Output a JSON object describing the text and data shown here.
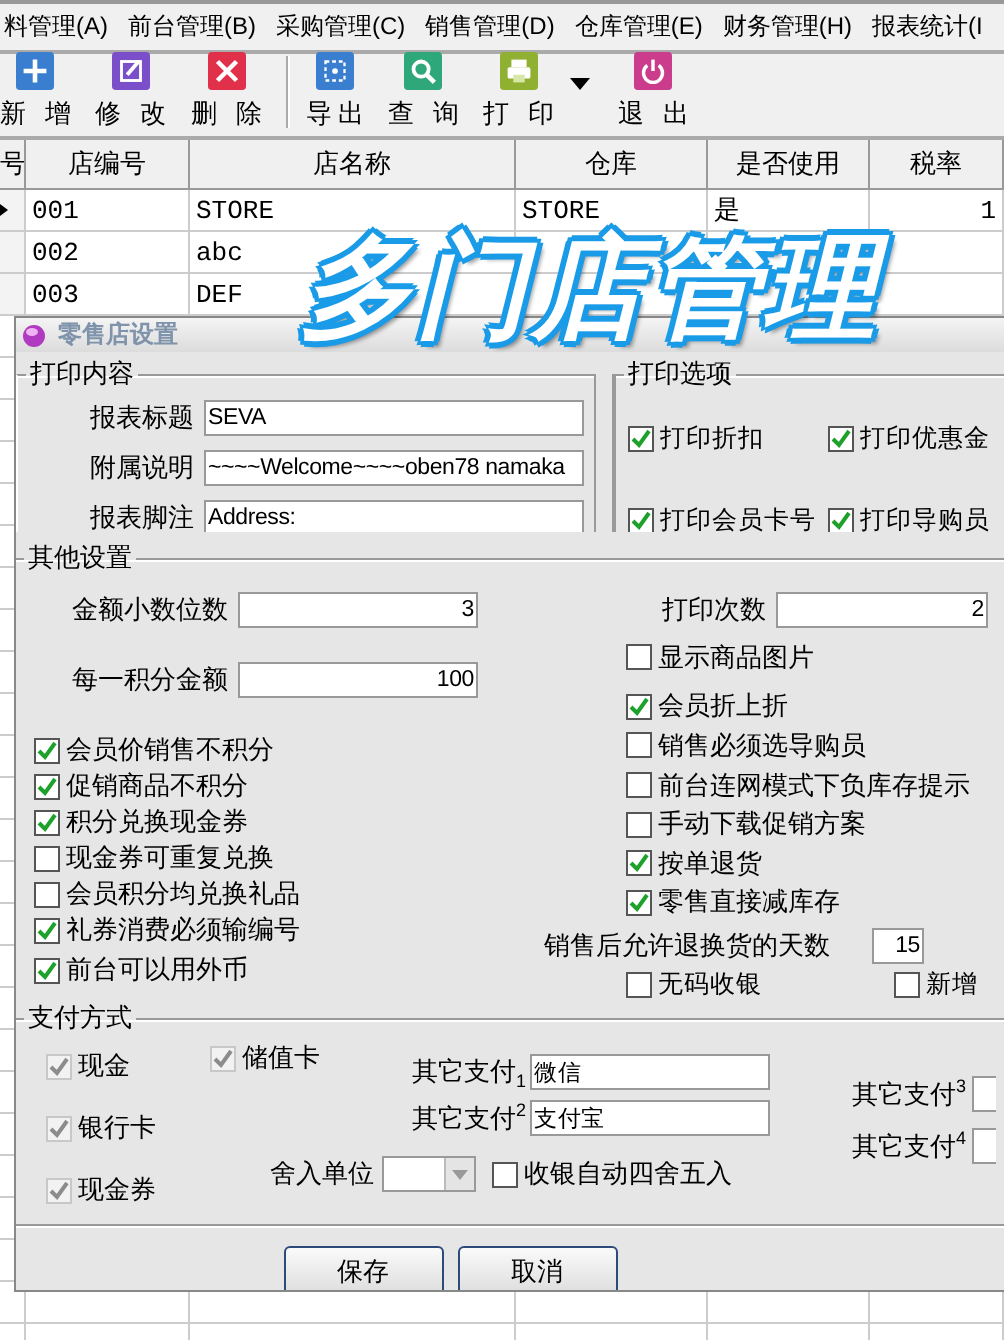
{
  "menu": [
    "料管理(A)",
    "前台管理(B)",
    "采购管理(C)",
    "销售管理(D)",
    "仓库管理(E)",
    "财务管理(H)",
    "报表统计(I"
  ],
  "toolbar": [
    {
      "label": "新 增",
      "kind": "add"
    },
    {
      "label": "修 改",
      "kind": "edit"
    },
    {
      "label": "删 除",
      "kind": "delete"
    },
    {
      "kind": "separator"
    },
    {
      "label": "导出",
      "kind": "export"
    },
    {
      "label": "查 询",
      "kind": "search"
    },
    {
      "label": "打 印",
      "kind": "print"
    },
    {
      "kind": "dropdown"
    },
    {
      "label": "退 出",
      "kind": "exit"
    }
  ],
  "table": {
    "columns": [
      "号",
      "店编号",
      "店名称",
      "仓库",
      "是否使用",
      "税率"
    ],
    "rows": [
      {
        "selected": true,
        "cells": [
          "001",
          "STORE",
          "STORE",
          "是",
          "1"
        ]
      },
      {
        "selected": false,
        "cells": [
          "002",
          "abc",
          null,
          null,
          null
        ]
      },
      {
        "selected": false,
        "cells": [
          "003",
          "DEF",
          null,
          null,
          null
        ]
      }
    ]
  },
  "banner": "多门店管理",
  "dialog": {
    "title": "零售店设置",
    "print_content": {
      "title": "打印内容",
      "fields": [
        {
          "label": "报表标题",
          "value": "SEVA"
        },
        {
          "label": "附属说明",
          "value": "~~~~Welcome~~~~oben78 namaka"
        },
        {
          "label": "报表脚注",
          "value": "Address:"
        }
      ]
    },
    "print_options": {
      "title": "打印选项",
      "options": [
        {
          "label": "打印折扣",
          "checked": true
        },
        {
          "label": "打印优惠金",
          "checked": true
        },
        {
          "label": "打印会员卡号",
          "checked": true
        },
        {
          "label": "打印导购员",
          "checked": true
        }
      ]
    },
    "other_settings": {
      "title": "其他设置",
      "decimal_places": {
        "label": "金额小数位数",
        "value": "3"
      },
      "points_amount": {
        "label": "每一积分金额",
        "value": "100"
      },
      "print_count": {
        "label": "打印次数",
        "value": "2"
      },
      "left_options": [
        {
          "label": "会员价销售不积分",
          "checked": true
        },
        {
          "label": "促销商品不积分",
          "checked": true
        },
        {
          "label": "积分兑换现金券",
          "checked": true
        },
        {
          "label": "现金券可重复兑换",
          "checked": false
        },
        {
          "label": "会员积分均兑换礼品",
          "checked": false
        },
        {
          "label": "礼券消费必须输编号",
          "checked": true
        },
        {
          "label": "前台可以用外币",
          "checked": true
        }
      ],
      "right_options": [
        {
          "label": "显示商品图片",
          "checked": false
        },
        {
          "label": "会员折上折",
          "checked": true
        },
        {
          "label": "销售必须选导购员",
          "checked": false
        },
        {
          "label": "前台连网模式下负库存提示",
          "checked": false
        },
        {
          "label": "手动下载促销方案",
          "checked": false
        },
        {
          "label": "按单退货",
          "checked": true
        },
        {
          "label": "零售直接减库存",
          "checked": true
        }
      ],
      "return_days": {
        "label": "销售后允许退换货的天数",
        "value": "15"
      },
      "bottom_options": [
        {
          "label": "无码收银",
          "checked": false
        },
        {
          "label": "新增",
          "checked": false
        }
      ]
    },
    "payment": {
      "title": "支付方式",
      "methods": [
        {
          "label": "现金",
          "checked": true,
          "disabled": true
        },
        {
          "label": "储值卡",
          "checked": true,
          "disabled": true
        },
        {
          "label": "银行卡",
          "checked": true,
          "disabled": true
        },
        {
          "label": "现金券",
          "checked": true,
          "disabled": true
        }
      ],
      "other": [
        {
          "label": "其它支付$_{1}$",
          "value": "微信"
        },
        {
          "label": "其它支付$^{2}$",
          "value": "支付宝"
        },
        {
          "label": "其它支付$^{3}$"
        },
        {
          "label": "其它支付$^{4}$"
        }
      ],
      "rounding": {
        "label": "舍入单位"
      },
      "auto_round": {
        "label": "收银自动四舍五入",
        "checked": false,
        "disabled": false
      }
    },
    "buttons": [
      "保存",
      "取消"
    ]
  }
}
